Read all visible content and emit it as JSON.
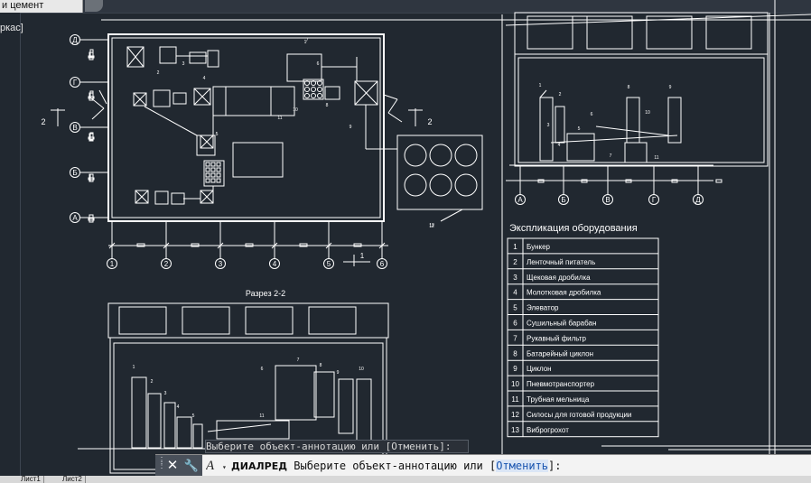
{
  "window": {
    "tab_title": "и цемент",
    "view_label": "ркас]"
  },
  "plan": {
    "axes_letters": [
      "Д",
      "Г",
      "В",
      "Б",
      "А"
    ],
    "axes_numbers": [
      "1",
      "2",
      "3",
      "4",
      "5",
      "6"
    ],
    "section_mark": "2",
    "dim_mark": "1",
    "callouts": [
      "1",
      "2",
      "3",
      "4",
      "5",
      "6",
      "7",
      "8",
      "9",
      "10",
      "11",
      "12"
    ]
  },
  "section_1": {
    "axes": [
      "А",
      "Б",
      "В",
      "Г",
      "Д"
    ],
    "callouts": [
      "1",
      "2",
      "3",
      "4",
      "5",
      "6",
      "7",
      "8",
      "9",
      "10",
      "11"
    ]
  },
  "section_2": {
    "title": "Разрез 2-2",
    "callouts": [
      "1",
      "2",
      "3",
      "4",
      "5",
      "6",
      "7",
      "8",
      "9",
      "10",
      "11"
    ]
  },
  "explication": {
    "title": "Экспликация оборудования",
    "rows": [
      {
        "n": "1",
        "name": "Бункер"
      },
      {
        "n": "2",
        "name": "Ленточный питатель"
      },
      {
        "n": "3",
        "name": "Щековая дробилка"
      },
      {
        "n": "4",
        "name": "Молотковая дробилка"
      },
      {
        "n": "5",
        "name": "Элеватор"
      },
      {
        "n": "6",
        "name": "Сушильный барабан"
      },
      {
        "n": "7",
        "name": "Рукавный фильтр"
      },
      {
        "n": "8",
        "name": "Батарейный циклон"
      },
      {
        "n": "9",
        "name": "Циклон"
      },
      {
        "n": "10",
        "name": "Пневмотранспортер"
      },
      {
        "n": "11",
        "name": "Трубная мельница"
      },
      {
        "n": "12",
        "name": "Силосы для готовой продукции"
      },
      {
        "n": "13",
        "name": "Виброгрохот"
      }
    ]
  },
  "tooltip": {
    "text": "Выберите объект-аннотацию или [Отменить]:"
  },
  "command_line": {
    "command": "ДИАЛРЕД",
    "prompt_text": " Выберите объект-аннотацию или [",
    "option": "Отменить",
    "prompt_end": "]:"
  },
  "layout_tabs": [
    "Лист1",
    "Лист2"
  ],
  "colors": {
    "background": "#212830",
    "lines": "#ffffff",
    "command_bar": "#f3f3f3"
  }
}
